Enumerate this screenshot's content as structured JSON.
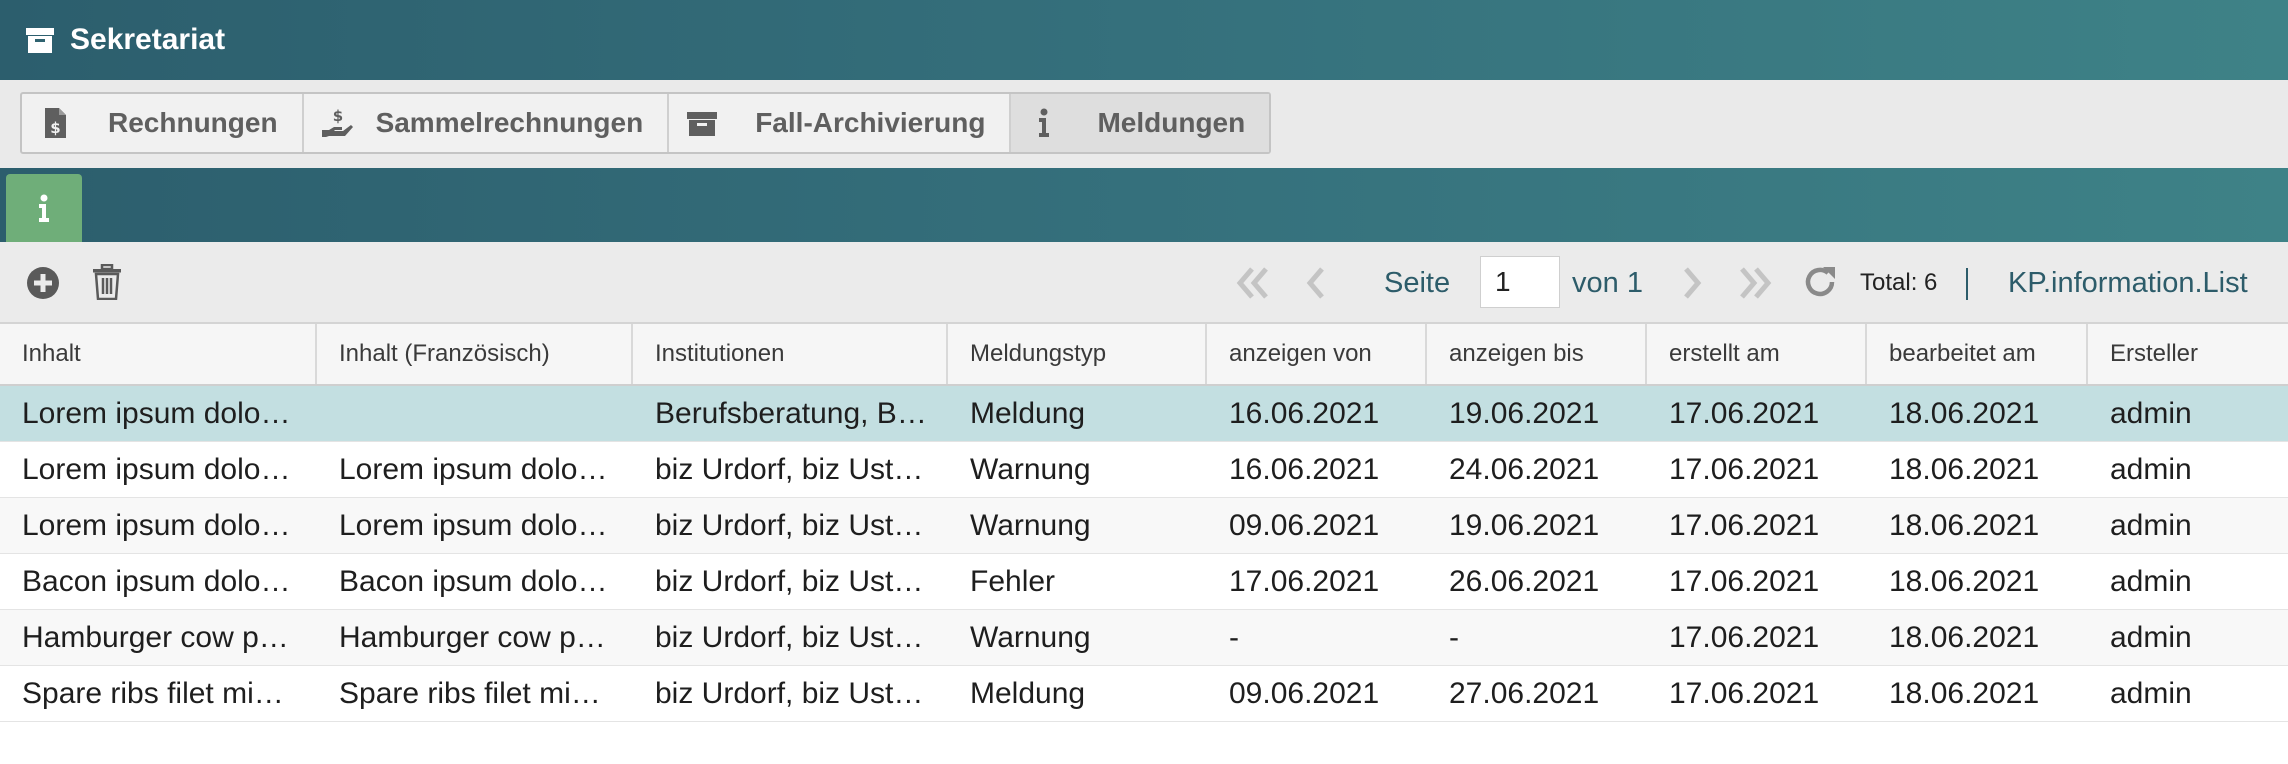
{
  "window": {
    "title": "Sekretariat",
    "title_icon": "archive-box-icon"
  },
  "tabs": [
    {
      "label": "Rechnungen",
      "icon": "invoice-dollar-icon",
      "active": false
    },
    {
      "label": "Sammelrechnungen",
      "icon": "hand-dollar-icon",
      "active": false
    },
    {
      "label": "Fall-Archivierung",
      "icon": "archive-box-icon",
      "active": false
    },
    {
      "label": "Meldungen",
      "icon": "info-icon",
      "active": true
    }
  ],
  "subtab": {
    "icon": "info-icon",
    "color": "#6fae79"
  },
  "toolbar": {
    "add_icon": "add-circle-icon",
    "delete_icon": "trash-icon",
    "page_label": "Seite",
    "page_value": "1",
    "of_label": "von 1",
    "total": "Total: 6",
    "separator": "|",
    "list_name": "KP.information.List"
  },
  "table": {
    "columns": [
      "Inhalt",
      "Inhalt (Französisch)",
      "Institutionen",
      "Meldungstyp",
      "anzeigen von",
      "anzeigen bis",
      "erstellt am",
      "bearbeitet am",
      "Ersteller"
    ],
    "rows": [
      {
        "selected": true,
        "cells": [
          "Lorem ipsum dolo…",
          "",
          "Berufsberatung, B…",
          "Meldung",
          "16.06.2021",
          "19.06.2021",
          "17.06.2021",
          "18.06.2021",
          "admin"
        ]
      },
      {
        "selected": false,
        "cells": [
          "Lorem ipsum dolo…",
          "Lorem ipsum dolo…",
          "biz Urdorf, biz Ust…",
          "Warnung",
          "16.06.2021",
          "24.06.2021",
          "17.06.2021",
          "18.06.2021",
          "admin"
        ]
      },
      {
        "selected": false,
        "cells": [
          "Lorem ipsum dolo…",
          "Lorem ipsum dolo…",
          "biz Urdorf, biz Ust…",
          "Warnung",
          "09.06.2021",
          "19.06.2021",
          "17.06.2021",
          "18.06.2021",
          "admin"
        ]
      },
      {
        "selected": false,
        "cells": [
          "Bacon ipsum dolo…",
          "Bacon ipsum dolo…",
          "biz Urdorf, biz Ust…",
          "Fehler",
          "17.06.2021",
          "26.06.2021",
          "17.06.2021",
          "18.06.2021",
          "admin"
        ]
      },
      {
        "selected": false,
        "cells": [
          "Hamburger cow p…",
          "Hamburger cow p…",
          "biz Urdorf, biz Ust…",
          "Warnung",
          "-",
          "-",
          "17.06.2021",
          "18.06.2021",
          "admin"
        ]
      },
      {
        "selected": false,
        "cells": [
          "Spare ribs filet mi…",
          "Spare ribs filet mi…",
          "biz Urdorf, biz Ust…",
          "Meldung",
          "09.06.2021",
          "27.06.2021",
          "17.06.2021",
          "18.06.2021",
          "admin"
        ]
      }
    ]
  },
  "colors": {
    "header_bar": "#2c5e6d",
    "selected_row": "#c3dfe1",
    "link_text": "#2d5c6a",
    "info_tab": "#6fae79"
  }
}
